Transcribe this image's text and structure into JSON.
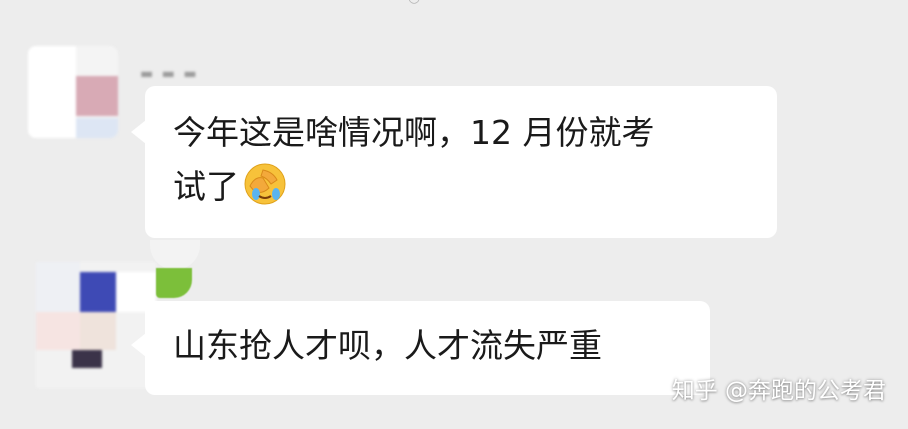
{
  "messages": [
    {
      "text_line1": "今年这是啥情况啊，12 月份就考",
      "text_line2": "试了",
      "emoji": "face-palm-emoji"
    },
    {
      "text_line1": "山东抢人才呗，人才流失严重"
    }
  ],
  "watermark": "知乎 @奔跑的公考君",
  "colors": {
    "background": "#ededed",
    "bubble": "#ffffff",
    "text": "#1a1a1a"
  }
}
